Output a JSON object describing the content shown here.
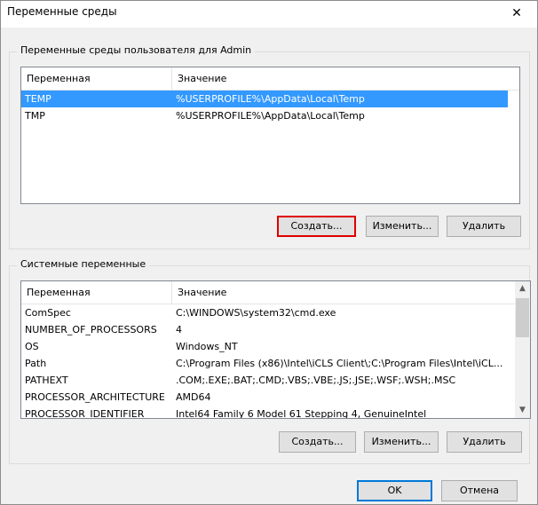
{
  "window": {
    "title": "Переменные среды",
    "close_icon": "✕"
  },
  "user_vars": {
    "legend": "Переменные среды пользователя для Admin",
    "columns": [
      "Переменная",
      "Значение"
    ],
    "rows": [
      {
        "name": "TEMP",
        "value": "%USERPROFILE%\\AppData\\Local\\Temp"
      },
      {
        "name": "TMP",
        "value": "%USERPROFILE%\\AppData\\Local\\Temp"
      }
    ],
    "selected_index": 0,
    "buttons": {
      "new": "Создать...",
      "edit": "Изменить...",
      "delete": "Удалить"
    }
  },
  "system_vars": {
    "legend": "Системные переменные",
    "columns": [
      "Переменная",
      "Значение"
    ],
    "rows": [
      {
        "name": "ComSpec",
        "value": "C:\\WINDOWS\\system32\\cmd.exe"
      },
      {
        "name": "NUMBER_OF_PROCESSORS",
        "value": "4"
      },
      {
        "name": "OS",
        "value": "Windows_NT"
      },
      {
        "name": "Path",
        "value": "C:\\Program Files (x86)\\Intel\\iCLS Client\\;C:\\Program Files\\Intel\\iCL..."
      },
      {
        "name": "PATHEXT",
        "value": ".COM;.EXE;.BAT;.CMD;.VBS;.VBE;.JS;.JSE;.WSF;.WSH;.MSC"
      },
      {
        "name": "PROCESSOR_ARCHITECTURE",
        "value": "AMD64"
      },
      {
        "name": "PROCESSOR_IDENTIFIER",
        "value": "Intel64 Family 6 Model 61 Stepping 4, GenuineIntel"
      }
    ],
    "buttons": {
      "new": "Создать...",
      "edit": "Изменить...",
      "delete": "Удалить"
    }
  },
  "dialog_buttons": {
    "ok": "OK",
    "cancel": "Отмена"
  },
  "icons": {
    "scroll_up": "▲",
    "scroll_down": "▼"
  },
  "colors": {
    "selection": "#3399ff",
    "highlight_border": "#e00000"
  }
}
